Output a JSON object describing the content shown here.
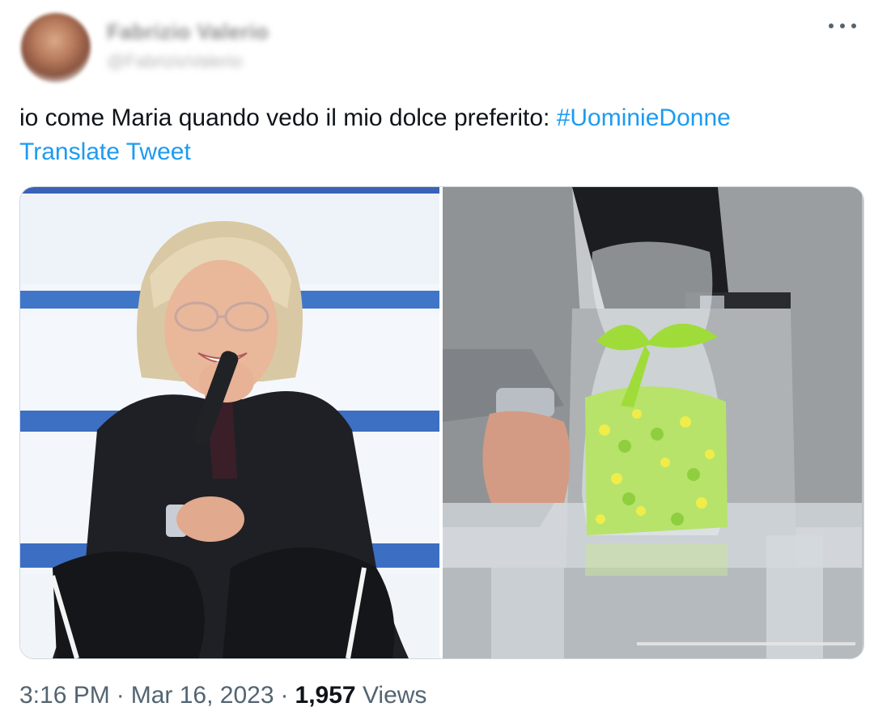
{
  "author": {
    "display_name": "Fabrizio Valerio",
    "handle": "@FabrizioValerio"
  },
  "tweet": {
    "text": "io come Maria quando vedo il mio dolce preferito: ",
    "hashtag": "#UominieDonne",
    "translate_label": "Translate Tweet"
  },
  "meta": {
    "time": "3:16 PM",
    "date": "Mar 16, 2023",
    "views_count": "1,957",
    "views_label": "Views"
  },
  "icons": {
    "more": "more-horizontal-icon"
  },
  "colors": {
    "link": "#1d9bf0",
    "text": "#0f1419",
    "secondary": "#536471",
    "candy_green": "#b7e36a",
    "ribbon": "#9fdc3a"
  }
}
